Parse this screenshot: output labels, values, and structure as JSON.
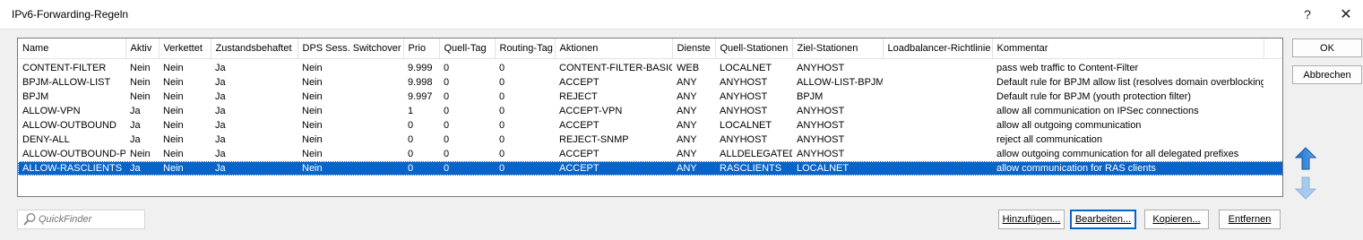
{
  "window": {
    "title": "IPv6-Forwarding-Regeln",
    "help_label": "?",
    "close_label": "✕"
  },
  "table": {
    "columns": [
      "Name",
      "Aktiv",
      "Verkettet",
      "Zustandsbehaftet",
      "DPS Sess. Switchover",
      "Prio",
      "Quell-Tag",
      "Routing-Tag",
      "Aktionen",
      "Dienste",
      "Quell-Stationen",
      "Ziel-Stationen",
      "Loadbalancer-Richtlinie",
      "Kommentar"
    ],
    "rows": [
      [
        "CONTENT-FILTER",
        "Nein",
        "Nein",
        "Ja",
        "Nein",
        "9.999",
        "0",
        "0",
        "CONTENT-FILTER-BASIC",
        "WEB",
        "LOCALNET",
        "ANYHOST",
        "",
        "pass web traffic to Content-Filter"
      ],
      [
        "BPJM-ALLOW-LIST",
        "Nein",
        "Nein",
        "Ja",
        "Nein",
        "9.998",
        "0",
        "0",
        "ACCEPT",
        "ANY",
        "ANYHOST",
        "ALLOW-LIST-BPJM",
        "",
        "Default rule for BPJM allow list (resolves domain overblocking)"
      ],
      [
        "BPJM",
        "Nein",
        "Nein",
        "Ja",
        "Nein",
        "9.997",
        "0",
        "0",
        "REJECT",
        "ANY",
        "ANYHOST",
        "BPJM",
        "",
        "Default rule for BPJM (youth protection filter)"
      ],
      [
        "ALLOW-VPN",
        "Ja",
        "Nein",
        "Ja",
        "Nein",
        "1",
        "0",
        "0",
        "ACCEPT-VPN",
        "ANY",
        "ANYHOST",
        "ANYHOST",
        "",
        "allow all communication on IPSec connections"
      ],
      [
        "ALLOW-OUTBOUND",
        "Ja",
        "Nein",
        "Ja",
        "Nein",
        "0",
        "0",
        "0",
        "ACCEPT",
        "ANY",
        "LOCALNET",
        "ANYHOST",
        "",
        "allow all outgoing communication"
      ],
      [
        "DENY-ALL",
        "Ja",
        "Nein",
        "Ja",
        "Nein",
        "0",
        "0",
        "0",
        "REJECT-SNMP",
        "ANY",
        "ANYHOST",
        "ANYHOST",
        "",
        "reject all communication"
      ],
      [
        "ALLOW-OUTBOUND-PD",
        "Nein",
        "Nein",
        "Ja",
        "Nein",
        "0",
        "0",
        "0",
        "ACCEPT",
        "ANY",
        "ALLDELEGATED",
        "ANYHOST",
        "",
        "allow outgoing communication for all delegated prefixes"
      ],
      [
        "ALLOW-RASCLIENTS",
        "Ja",
        "Nein",
        "Ja",
        "Nein",
        "0",
        "0",
        "0",
        "ACCEPT",
        "ANY",
        "RASCLIENTS",
        "LOCALNET",
        "",
        "allow communication for RAS clients"
      ]
    ],
    "selected_row": 7,
    "selection_color": "#0a64c8"
  },
  "side_buttons": {
    "ok_label": "OK",
    "cancel_label": "Abbrechen",
    "move_up_icon": "arrow-up-icon",
    "move_down_icon": "arrow-down-icon"
  },
  "quickfinder": {
    "placeholder": "QuickFinder",
    "value": "",
    "icon": "magnifier-icon"
  },
  "bottom_buttons": {
    "add_label": "Hinzufügen...",
    "edit_label": "Bearbeiten...",
    "copy_label": "Kopieren...",
    "remove_label": "Entfernen"
  }
}
